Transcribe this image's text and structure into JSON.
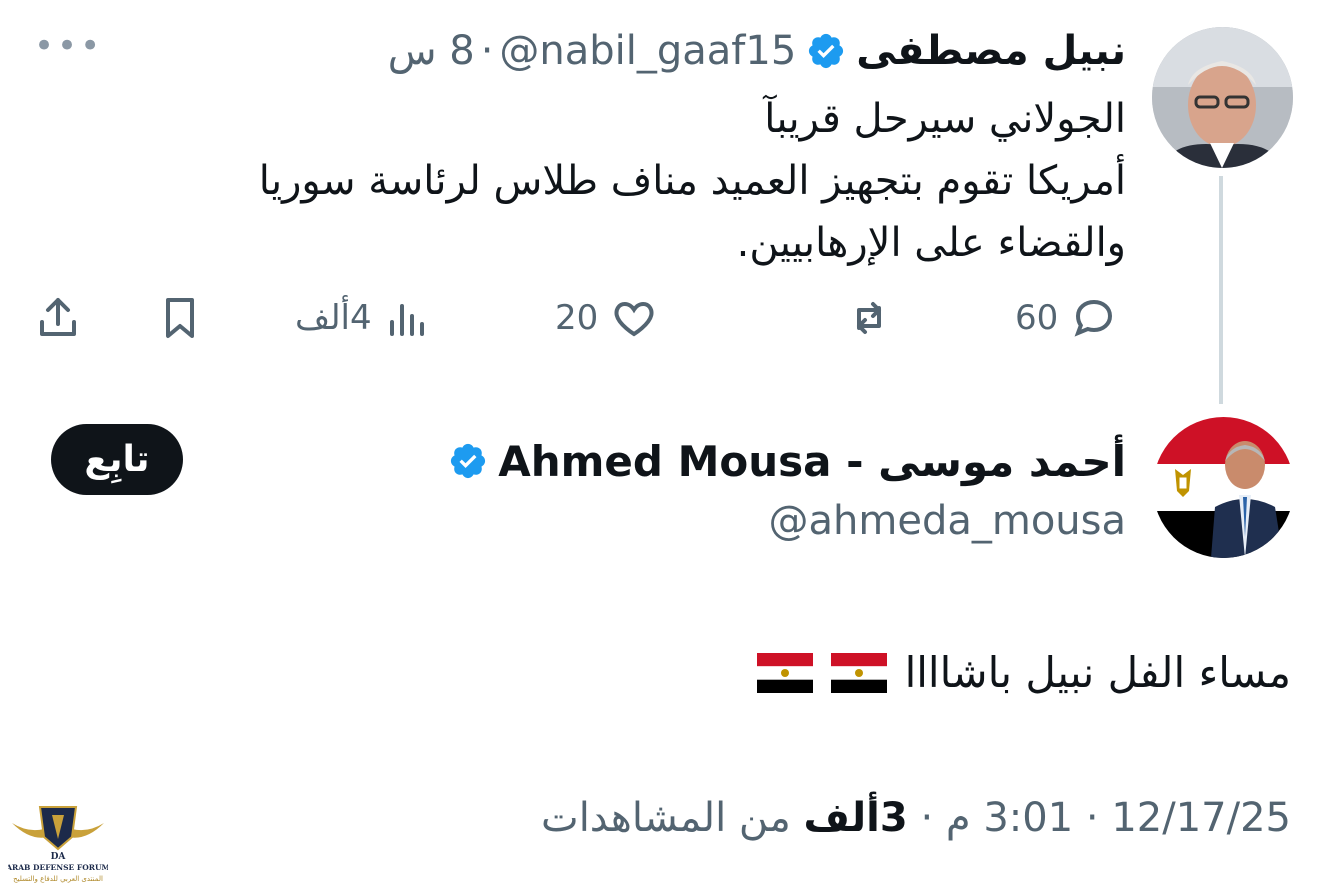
{
  "parent_tweet": {
    "display_name": "نبيل مصطفى",
    "handle": "@nabil_gaaf15",
    "separator": "·",
    "time": "8 س",
    "lines": [
      "الجولاني سيرحل قريبآ",
      "أمريكا تقوم بتجهيز العميد مناف طلاس لرئاسة سوريا",
      "والقضاء على الإرهابيين."
    ],
    "actions": {
      "replies": "60",
      "likes": "20",
      "views": "4ألف"
    }
  },
  "main_tweet": {
    "display_name": "أحمد موسى - Ahmed Mousa",
    "handle": "@ahmeda_mousa",
    "follow_label": "تابِع",
    "text": "مساء الفل نبيل باشاااا",
    "timestamp": "3:01 م · 12/17/25",
    "timestamp_date": "12/17/25",
    "timestamp_time": "3:01 م",
    "views_count": "3ألف",
    "views_label": "من المشاهدات"
  },
  "watermark": {
    "name": "ARAB DEFENSE FORUM",
    "subtitle": "المنتدى العربي للدفاع والتسليح",
    "abbr": "DA"
  },
  "colors": {
    "verified": "#1d9bf0",
    "text": "#0f1419",
    "muted": "#536471"
  }
}
